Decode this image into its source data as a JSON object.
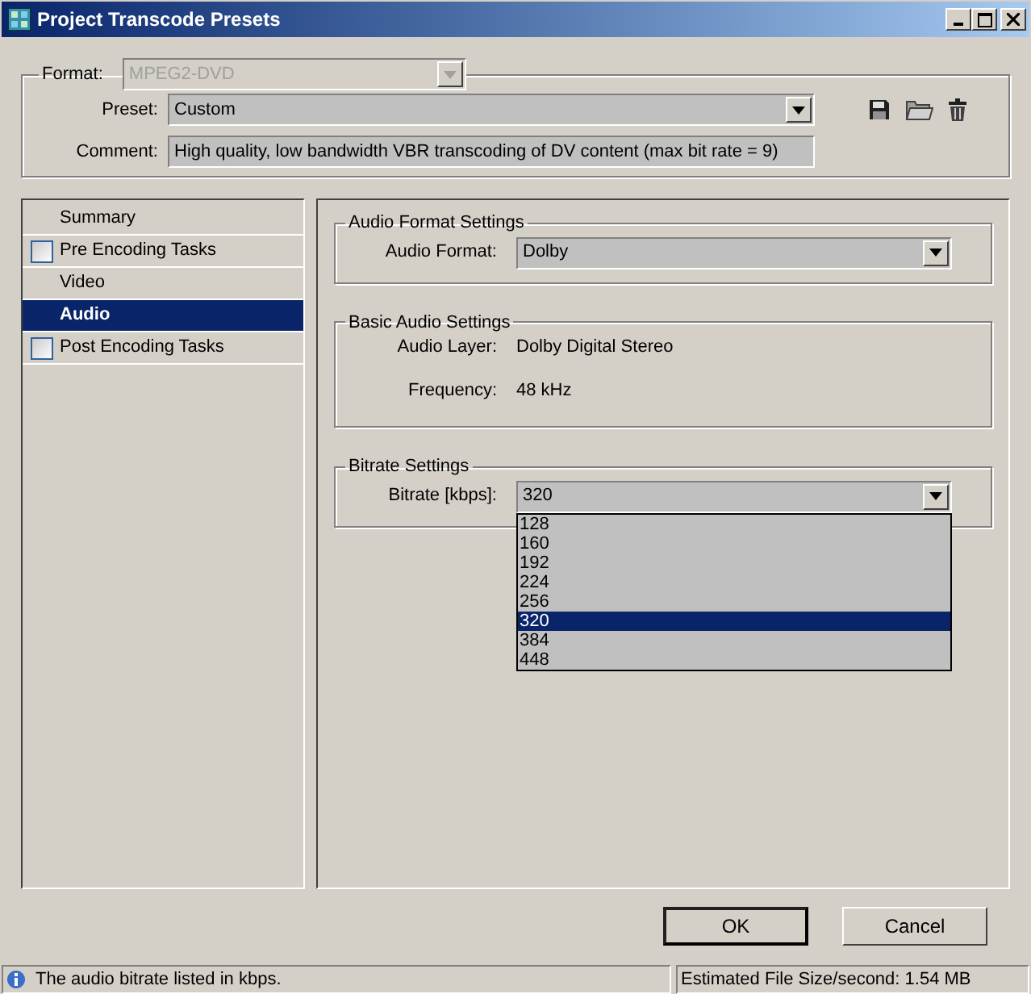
{
  "window": {
    "title": "Project Transcode Presets"
  },
  "format": {
    "label": "Format:",
    "value": "MPEG2-DVD",
    "disabled": true
  },
  "preset": {
    "label": "Preset:",
    "value": "Custom"
  },
  "comment": {
    "label": "Comment:",
    "value": "High quality, low bandwidth VBR transcoding of DV content (max bit rate = 9)"
  },
  "sidebar": {
    "items": [
      {
        "label": "Summary",
        "kind": "plain",
        "selected": false
      },
      {
        "label": "Pre Encoding Tasks",
        "kind": "checkbox",
        "checked": false,
        "selected": false
      },
      {
        "label": "Video",
        "kind": "plain",
        "selected": false
      },
      {
        "label": "Audio",
        "kind": "plain",
        "selected": true
      },
      {
        "label": "Post Encoding Tasks",
        "kind": "checkbox",
        "checked": false,
        "selected": false
      }
    ]
  },
  "groups": [
    {
      "title": "Audio Format Settings",
      "rows": [
        {
          "kind": "combo",
          "label": "Audio Format:",
          "value": "Dolby"
        }
      ]
    },
    {
      "title": "Basic Audio Settings",
      "rows": [
        {
          "kind": "text",
          "label": "Audio Layer:",
          "value": "Dolby Digital Stereo"
        },
        {
          "kind": "text",
          "label": "Frequency:",
          "value": "48 kHz"
        }
      ]
    },
    {
      "title": "Bitrate Settings",
      "rows": [
        {
          "kind": "combo",
          "label": "Bitrate [kbps]:",
          "value": "320",
          "expanded": true,
          "options": [
            {
              "label": "128",
              "selected": false
            },
            {
              "label": "160",
              "selected": false
            },
            {
              "label": "192",
              "selected": false
            },
            {
              "label": "224",
              "selected": false
            },
            {
              "label": "256",
              "selected": false
            },
            {
              "label": "320",
              "selected": true
            },
            {
              "label": "384",
              "selected": false
            },
            {
              "label": "448",
              "selected": false
            }
          ]
        }
      ]
    }
  ],
  "buttons": [
    {
      "label": "OK",
      "default": true
    },
    {
      "label": "Cancel",
      "default": false
    }
  ],
  "status_bar": {
    "message": "The audio bitrate listed in kbps.",
    "file_size": "Estimated File Size/second: 1.54 MB"
  }
}
